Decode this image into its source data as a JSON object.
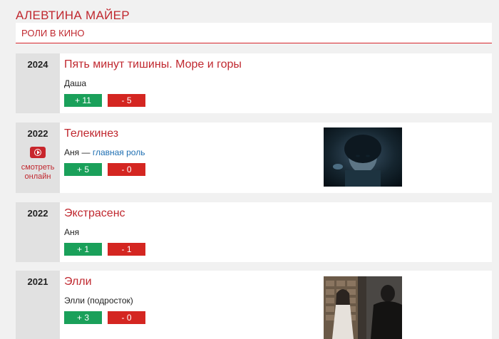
{
  "page": {
    "title": "АЛЕВТИНА МАЙЕР"
  },
  "section": {
    "title": "РОЛИ В КИНО"
  },
  "films": [
    {
      "year": "2024",
      "title": "Пять минут тишины. Море и горы",
      "role": "Даша",
      "votes_up": "+ 11",
      "votes_down": "- 5"
    },
    {
      "year": "2022",
      "title": "Телекинез",
      "role": "Аня",
      "role_separator": "—",
      "role_note": "главная роль",
      "votes_up": "+ 5",
      "votes_down": "- 0",
      "watch_label_1": "смотреть",
      "watch_label_2": "онлайн"
    },
    {
      "year": "2022",
      "title": "Экстрасенс",
      "role": "Аня",
      "votes_up": "+ 1",
      "votes_down": "- 1"
    },
    {
      "year": "2021",
      "title": "Элли",
      "role": "Элли (подросток)",
      "votes_up": "+ 3",
      "votes_down": "- 0"
    }
  ]
}
